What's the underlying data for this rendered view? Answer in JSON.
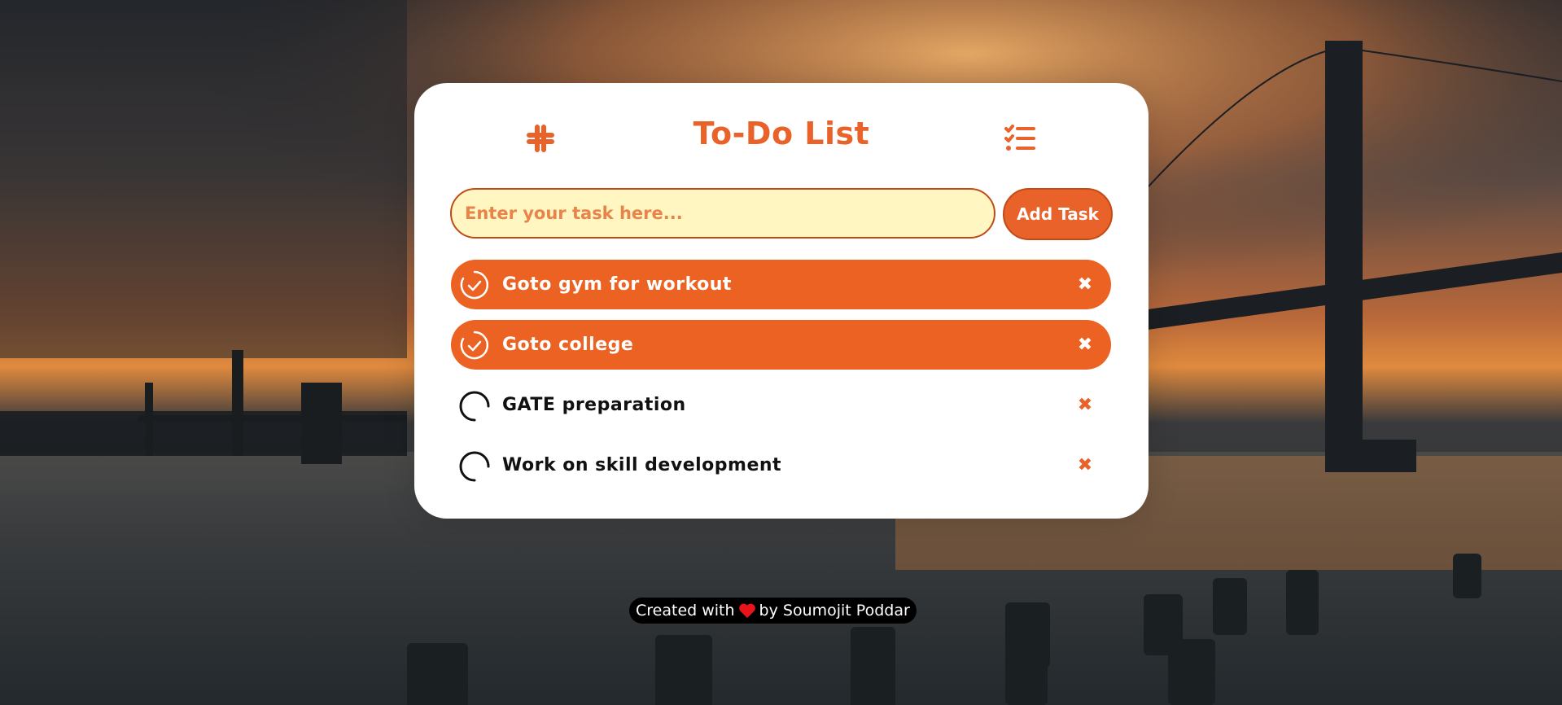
{
  "app": {
    "title": "To-Do List",
    "logo_icon": "hashtag-slack-icon",
    "list_icon": "list-check-icon",
    "accent_color": "#e8622a",
    "input_bg_color": "#fff6c2"
  },
  "input": {
    "placeholder": "Enter your task here...",
    "value": ""
  },
  "add_button": {
    "label": "Add Task"
  },
  "tasks": [
    {
      "label": "Goto gym for workout",
      "completed": true,
      "delete_icon": "close-icon"
    },
    {
      "label": "Goto college",
      "completed": true,
      "delete_icon": "close-icon"
    },
    {
      "label": "GATE preparation",
      "completed": false,
      "delete_icon": "close-icon"
    },
    {
      "label": "Work on skill development",
      "completed": false,
      "delete_icon": "close-icon"
    }
  ],
  "footer": {
    "prefix": "Created with",
    "heart_icon": "heart-icon",
    "suffix": "by Soumojit Poddar"
  }
}
